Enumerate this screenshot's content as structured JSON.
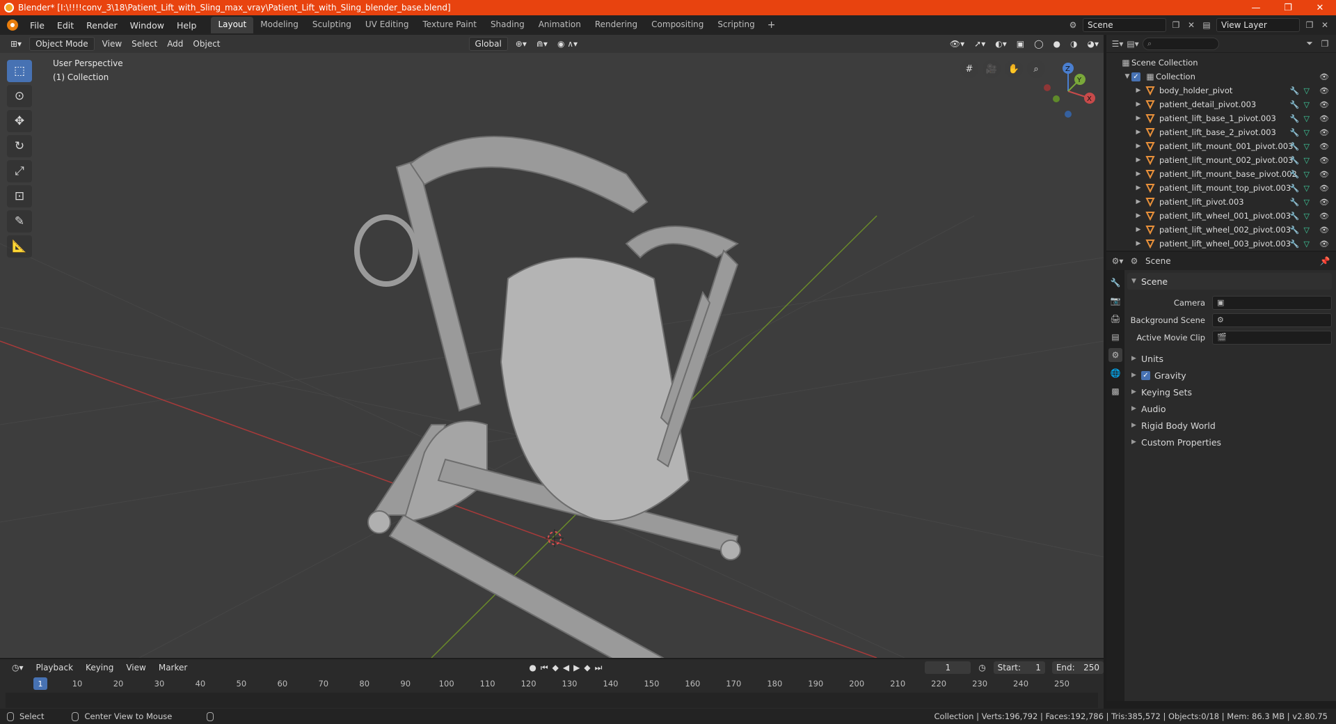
{
  "window": {
    "title": "Blender* [I:\\!!!!conv_3\\18\\Patient_Lift_with_Sling_max_vray\\Patient_Lift_with_Sling_blender_base.blend]",
    "minimize": "—",
    "maximize": "❐",
    "close": "✕"
  },
  "menu": {
    "items": [
      "File",
      "Edit",
      "Render",
      "Window",
      "Help"
    ],
    "workspaces": [
      "Layout",
      "Modeling",
      "Sculpting",
      "UV Editing",
      "Texture Paint",
      "Shading",
      "Animation",
      "Rendering",
      "Compositing",
      "Scripting"
    ],
    "add_tab": "+",
    "scene_name": "Scene",
    "view_layer": "View Layer"
  },
  "viewport": {
    "mode": "Object Mode",
    "menus": [
      "View",
      "Select",
      "Add",
      "Object"
    ],
    "orientation": "Global",
    "perspective_label": "User Perspective",
    "collection_label": "(1) Collection",
    "gizmo_axes": {
      "x": "X",
      "y": "Y",
      "z": "Z"
    }
  },
  "outliner": {
    "scene_collection": "Scene Collection",
    "collection": "Collection",
    "objects": [
      {
        "name": "body_holder_pivot"
      },
      {
        "name": "patient_detail_pivot.003"
      },
      {
        "name": "patient_lift_base_1_pivot.003"
      },
      {
        "name": "patient_lift_base_2_pivot.003"
      },
      {
        "name": "patient_lift_mount_001_pivot.003"
      },
      {
        "name": "patient_lift_mount_002_pivot.003"
      },
      {
        "name": "patient_lift_mount_base_pivot.002"
      },
      {
        "name": "patient_lift_mount_top_pivot.003"
      },
      {
        "name": "patient_lift_pivot.003"
      },
      {
        "name": "patient_lift_wheel_001_pivot.003"
      },
      {
        "name": "patient_lift_wheel_002_pivot.003"
      },
      {
        "name": "patient_lift_wheel_003_pivot.003"
      }
    ]
  },
  "properties": {
    "context": "Scene",
    "panel_title": "Scene",
    "rows": [
      {
        "label": "Camera"
      },
      {
        "label": "Background Scene"
      },
      {
        "label": "Active Movie Clip"
      }
    ],
    "subpanels": [
      "Units",
      "Gravity",
      "Keying Sets",
      "Audio",
      "Rigid Body World",
      "Custom Properties"
    ]
  },
  "timeline": {
    "menus": [
      "Playback",
      "Keying",
      "View",
      "Marker"
    ],
    "current_frame": "1",
    "start_label": "Start:",
    "start": "1",
    "end_label": "End:",
    "end": "250",
    "ticks": [
      "10",
      "20",
      "30",
      "40",
      "50",
      "60",
      "70",
      "80",
      "90",
      "100",
      "110",
      "120",
      "130",
      "140",
      "150",
      "160",
      "170",
      "180",
      "190",
      "200",
      "210",
      "220",
      "230",
      "240",
      "250"
    ]
  },
  "status": {
    "left": "Select",
    "middle": "Center View to Mouse",
    "right": "Collection | Verts:196,792 | Faces:192,786 | Tris:385,572 | Objects:0/18 | Mem: 86.3 MB | v2.80.75"
  }
}
